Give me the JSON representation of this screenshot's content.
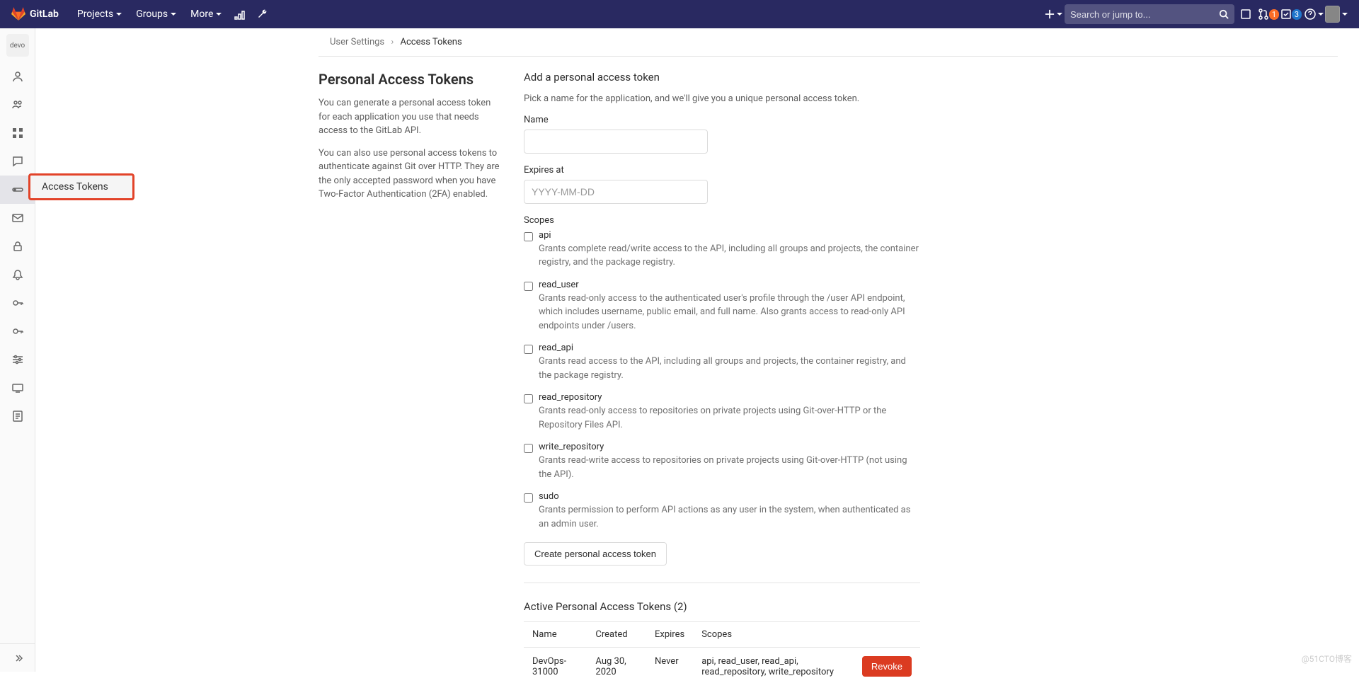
{
  "topbar": {
    "brand": "GitLab",
    "nav": [
      "Projects",
      "Groups",
      "More"
    ],
    "search_placeholder": "Search or jump to...",
    "mr_count": "1",
    "todo_count": "3"
  },
  "sidebar": {
    "avatar_text": "devo",
    "flyout_label": "Access Tokens"
  },
  "breadcrumb": {
    "parent": "User Settings",
    "current": "Access Tokens"
  },
  "left_panel": {
    "title": "Personal Access Tokens",
    "p1": "You can generate a personal access token for each application you use that needs access to the GitLab API.",
    "p2": "You can also use personal access tokens to authenticate against Git over HTTP. They are the only accepted password when you have Two-Factor Authentication (2FA) enabled."
  },
  "form": {
    "heading": "Add a personal access token",
    "sub": "Pick a name for the application, and we'll give you a unique personal access token.",
    "name_label": "Name",
    "expires_label": "Expires at",
    "expires_placeholder": "YYYY-MM-DD",
    "scopes_label": "Scopes",
    "submit": "Create personal access token",
    "scopes": [
      {
        "name": "api",
        "desc": "Grants complete read/write access to the API, including all groups and projects, the container registry, and the package registry."
      },
      {
        "name": "read_user",
        "desc": "Grants read-only access to the authenticated user's profile through the /user API endpoint, which includes username, public email, and full name. Also grants access to read-only API endpoints under /users."
      },
      {
        "name": "read_api",
        "desc": "Grants read access to the API, including all groups and projects, the container registry, and the package registry."
      },
      {
        "name": "read_repository",
        "desc": "Grants read-only access to repositories on private projects using Git-over-HTTP or the Repository Files API."
      },
      {
        "name": "write_repository",
        "desc": "Grants read-write access to repositories on private projects using Git-over-HTTP (not using the API)."
      },
      {
        "name": "sudo",
        "desc": "Grants permission to perform API actions as any user in the system, when authenticated as an admin user."
      }
    ]
  },
  "active_tokens": {
    "title": "Active Personal Access Tokens (2)",
    "headers": [
      "Name",
      "Created",
      "Expires",
      "Scopes"
    ],
    "rows": [
      {
        "name": "DevOps-31000",
        "created": "Aug 30, 2020",
        "expires": "Never",
        "scopes": "api, read_user, read_api, read_repository, write_repository",
        "action": "Revoke"
      }
    ]
  },
  "watermark": "@51CTO博客"
}
